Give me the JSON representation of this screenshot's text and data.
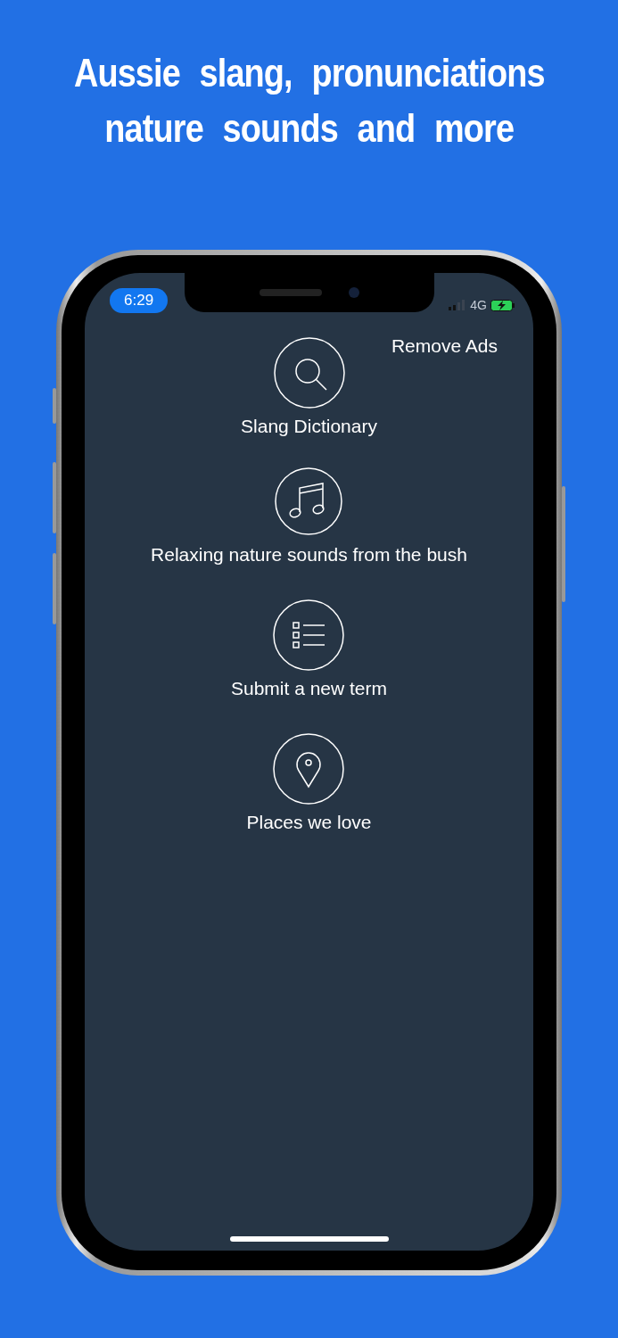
{
  "headline": [
    "Aussie slang, pronunciations",
    "nature sounds and more"
  ],
  "status_bar": {
    "time": "6:29",
    "network": "4G"
  },
  "remove_ads": "Remove Ads",
  "menu": [
    {
      "kind": "search",
      "label": "Slang Dictionary"
    },
    {
      "kind": "music",
      "label": "Relaxing nature sounds from the bush"
    },
    {
      "kind": "list",
      "label": "Submit a new term"
    },
    {
      "kind": "pin",
      "label": "Places we love"
    }
  ]
}
